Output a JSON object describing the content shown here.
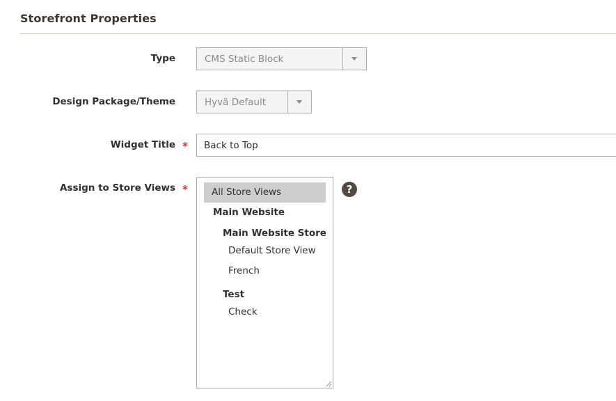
{
  "section": {
    "title": "Storefront Properties"
  },
  "fields": {
    "type": {
      "label": "Type",
      "value": "CMS Static Block"
    },
    "design": {
      "label": "Design Package/Theme",
      "value": "Hyvä Default"
    },
    "widget_title": {
      "label": "Widget Title",
      "required_mark": "*",
      "value": "Back to Top"
    },
    "store_views": {
      "label": "Assign to Store Views",
      "required_mark": "*",
      "options": {
        "all": "All Store Views",
        "website": "Main Website",
        "store_main": "Main Website Store",
        "view_default": "Default Store View",
        "view_french": "French",
        "store_test": "Test",
        "view_check": "Check"
      },
      "selected": "All Store Views",
      "help_icon": "question-circle-icon",
      "help_glyph": "?"
    }
  },
  "colors": {
    "required": "#e02b27",
    "selected_bg": "#cecece",
    "help_bg": "#514943"
  }
}
